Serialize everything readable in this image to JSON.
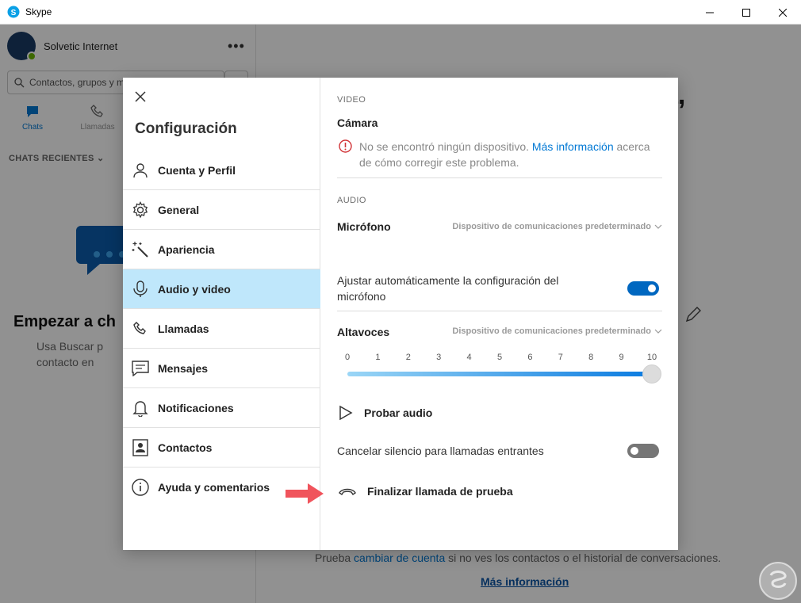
{
  "window": {
    "title": "Skype"
  },
  "sidebar": {
    "profile_name": "Solvetic Internet",
    "search_placeholder": "Contactos, grupos y m",
    "tabs": [
      {
        "label": "Chats",
        "active": true
      },
      {
        "label": "Llamadas",
        "active": false
      }
    ],
    "recent_label": "CHATS RECIENTES",
    "empty_title": "Empezar a ch",
    "empty_hint": "Usa Buscar p contacto en"
  },
  "main": {
    "heading_partial": "a,",
    "footer_prefix": "Prueba",
    "footer_link": "cambiar de cuenta",
    "footer_suffix": "si no ves los contactos o el historial de conversaciones.",
    "more_info": "Más información"
  },
  "dialog": {
    "title": "Configuración",
    "menu": [
      {
        "label": "Cuenta y Perfil",
        "icon": "person-icon",
        "active": false
      },
      {
        "label": "General",
        "icon": "gear-icon",
        "active": false
      },
      {
        "label": "Apariencia",
        "icon": "magic-wand-icon",
        "active": false
      },
      {
        "label": "Audio y video",
        "icon": "microphone-icon",
        "active": true
      },
      {
        "label": "Llamadas",
        "icon": "phone-icon",
        "active": false
      },
      {
        "label": "Mensajes",
        "icon": "message-icon",
        "active": false
      },
      {
        "label": "Notificaciones",
        "icon": "bell-icon",
        "active": false
      },
      {
        "label": "Contactos",
        "icon": "contact-card-icon",
        "active": false
      },
      {
        "label": "Ayuda y comentarios",
        "icon": "info-icon",
        "active": false
      }
    ],
    "video_section": "VIDEO",
    "camera_label": "Cámara",
    "camera_error": "No se encontró ningún dispositivo.",
    "camera_error_link": "Más información",
    "camera_error_suffix": "acerca de cómo corregir este problema.",
    "audio_section": "AUDIO",
    "microphone_label": "Micrófono",
    "microphone_device": "Dispositivo de comunicaciones predeterminado",
    "auto_adjust_label": "Ajustar automáticamente la configuración del micrófono",
    "auto_adjust_on": true,
    "speakers_label": "Altavoces",
    "speakers_device": "Dispositivo de comunicaciones predeterminado",
    "volume_ticks": [
      "0",
      "1",
      "2",
      "3",
      "4",
      "5",
      "6",
      "7",
      "8",
      "9",
      "10"
    ],
    "volume_value": 10,
    "test_audio": "Probar audio",
    "unmute_label": "Cancelar silencio para llamadas entrantes",
    "unmute_on": false,
    "end_test_call": "Finalizar llamada de prueba"
  },
  "colors": {
    "accent": "#0078d4",
    "active_menu": "#bfe7fb",
    "toggle_on": "#0067c0",
    "toggle_off": "#767676",
    "arrow": "#f0545c"
  }
}
